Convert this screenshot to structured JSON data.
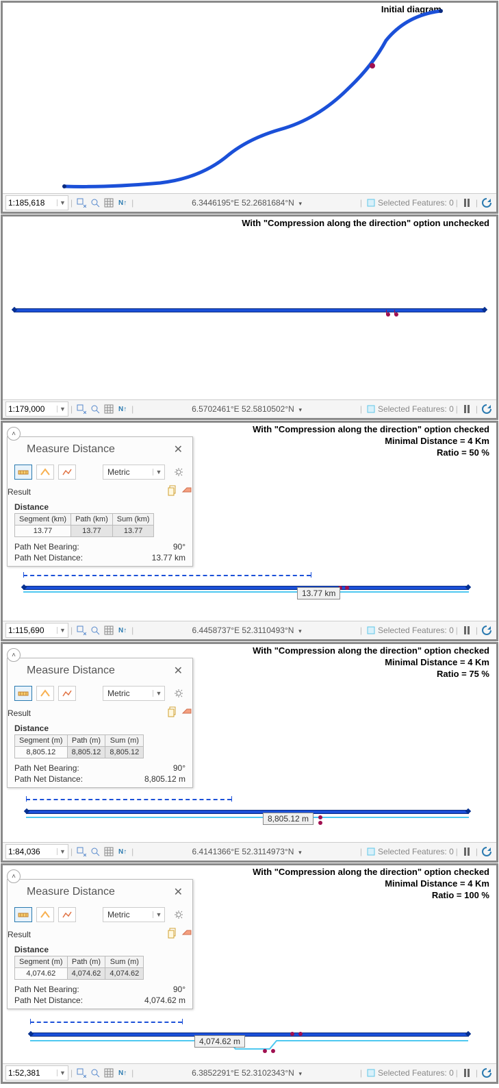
{
  "panels": [
    {
      "caption": "Initial diagram",
      "scale": "1:185,618",
      "coords": "6.3446195°E 52.2681684°N",
      "selected": "Selected Features: 0"
    },
    {
      "caption": "With \"Compression along the direction\" option unchecked",
      "scale": "1:179,000",
      "coords": "6.5702461°E 52.5810502°N",
      "selected": "Selected Features: 0"
    },
    {
      "caption_l1": "With \"Compression along the direction\" option checked",
      "caption_l2": "Minimal Distance = 4 Km",
      "caption_l3": "Ratio = 50 %",
      "scale": "1:115,690",
      "coords": "6.4458737°E 52.3110493°N",
      "selected": "Selected Features: 0",
      "measure": {
        "title": "Measure Distance",
        "unit": "Metric",
        "result_label": "Result",
        "distance_label": "Distance",
        "headers": [
          "Segment (km)",
          "Path (km)",
          "Sum (km)"
        ],
        "values": [
          "13.77",
          "13.77",
          "13.77"
        ],
        "bearing_label": "Path Net Bearing:",
        "bearing": "90°",
        "distance_net_label": "Path Net Distance:",
        "distance_net": "13.77 km"
      },
      "line_label": "13.77 km"
    },
    {
      "caption_l1": "With \"Compression along the direction\" option checked",
      "caption_l2": "Minimal Distance = 4 Km",
      "caption_l3": "Ratio = 75 %",
      "scale": "1:84,036",
      "coords": "6.4141366°E 52.3114973°N",
      "selected": "Selected Features: 0",
      "measure": {
        "title": "Measure Distance",
        "unit": "Metric",
        "result_label": "Result",
        "distance_label": "Distance",
        "headers": [
          "Segment (m)",
          "Path (m)",
          "Sum (m)"
        ],
        "values": [
          "8,805.12",
          "8,805.12",
          "8,805.12"
        ],
        "bearing_label": "Path Net Bearing:",
        "bearing": "90°",
        "distance_net_label": "Path Net Distance:",
        "distance_net": "8,805.12 m"
      },
      "line_label": "8,805.12 m"
    },
    {
      "caption_l1": "With \"Compression along the direction\" option checked",
      "caption_l2": "Minimal Distance = 4 Km",
      "caption_l3": "Ratio = 100 %",
      "scale": "1:52,381",
      "coords": "6.3852291°E 52.3102343°N",
      "selected": "Selected Features: 0",
      "measure": {
        "title": "Measure Distance",
        "unit": "Metric",
        "result_label": "Result",
        "distance_label": "Distance",
        "headers": [
          "Segment (m)",
          "Path (m)",
          "Sum (m)"
        ],
        "values": [
          "4,074.62",
          "4,074.62",
          "4,074.62"
        ],
        "bearing_label": "Path Net Bearing:",
        "bearing": "90°",
        "distance_net_label": "Path Net Distance:",
        "distance_net": "4,074.62 m"
      },
      "line_label": "4,074.62 m"
    }
  ]
}
